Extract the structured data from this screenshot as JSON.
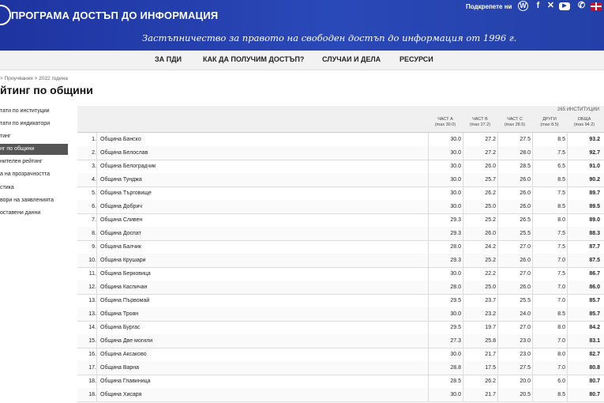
{
  "header": {
    "org_name": "ПРОГРАМА ДОСТЪП ДО ИНФОРМАЦИЯ",
    "tagline": "Застъпничество за правото на свободен достъп до информация от 1996 г.",
    "support_label": "Подкрепете ни",
    "social_icons": [
      "wordpress-icon",
      "facebook-icon",
      "twitter-icon",
      "youtube-icon",
      "phone-icon",
      "uk-flag-icon"
    ]
  },
  "nav": {
    "items": [
      "ЗА ПДИ",
      "КАК ДА ПОЛУЧИМ ДОСТЪП?",
      "СЛУЧАИ И ДЕЛА",
      "РЕСУРСИ"
    ]
  },
  "breadcrumb": "> Проучвания > 2022 година",
  "page_title": "йтинг по общини",
  "sidebar": {
    "items": [
      {
        "label": "тати по институции",
        "active": false
      },
      {
        "label": "тати по индикатори",
        "active": false
      },
      {
        "label": "тинг",
        "active": false
      },
      {
        "label": "нг по общини",
        "active": true
      },
      {
        "label": "нителен рейтинг",
        "active": false
      },
      {
        "label": "а на прозрачността",
        "active": false
      },
      {
        "label": "стика",
        "active": false
      },
      {
        "label": "вори на заявленията",
        "active": false
      },
      {
        "label": "оставени данни",
        "active": false
      }
    ]
  },
  "table": {
    "count_label": "265 ИНСТИТУЦИИ",
    "headers": [
      {
        "label": "ЧАСТ А",
        "sub": "(max 30.0)"
      },
      {
        "label": "ЧАСТ В",
        "sub": "(max 27.2)"
      },
      {
        "label": "ЧАСТ С",
        "sub": "(max 28.5)"
      },
      {
        "label": "ДРУГИ",
        "sub": "(max 8.5)"
      },
      {
        "label": "ОБЩА",
        "sub": "(max 94.2)"
      }
    ],
    "rows": [
      {
        "rank": "1.",
        "name": "Община Банско",
        "a": "30.0",
        "b": "27.2",
        "c": "27.5",
        "o": "8.5",
        "t": "93.2"
      },
      {
        "rank": "2.",
        "name": "Община Белослав",
        "a": "30.0",
        "b": "27.2",
        "c": "28.0",
        "o": "7.5",
        "t": "92.7"
      },
      {
        "rank": "3.",
        "name": "Община Белоградчик",
        "a": "30.0",
        "b": "26.0",
        "c": "28.5",
        "o": "6.5",
        "t": "91.0"
      },
      {
        "rank": "4.",
        "name": "Община Тунджа",
        "a": "30.0",
        "b": "25.7",
        "c": "26.0",
        "o": "8.5",
        "t": "90.2"
      },
      {
        "rank": "5.",
        "name": "Община Търговище",
        "a": "30.0",
        "b": "26.2",
        "c": "26.0",
        "o": "7.5",
        "t": "89.7"
      },
      {
        "rank": "6.",
        "name": "Община Добрич",
        "a": "30.0",
        "b": "25.0",
        "c": "26.0",
        "o": "8.5",
        "t": "89.5"
      },
      {
        "rank": "7.",
        "name": "Община Сливен",
        "a": "29.3",
        "b": "25.2",
        "c": "26.5",
        "o": "8.0",
        "t": "89.0"
      },
      {
        "rank": "8.",
        "name": "Община Доспат",
        "a": "29.3",
        "b": "26.0",
        "c": "25.5",
        "o": "7.5",
        "t": "88.3"
      },
      {
        "rank": "9.",
        "name": "Община Балчик",
        "a": "28.0",
        "b": "24.2",
        "c": "27.0",
        "o": "7.5",
        "t": "87.7"
      },
      {
        "rank": "10.",
        "name": "Община Крушари",
        "a": "29.3",
        "b": "25.2",
        "c": "26.0",
        "o": "7.0",
        "t": "87.5"
      },
      {
        "rank": "11.",
        "name": "Община Берковица",
        "a": "30.0",
        "b": "22.2",
        "c": "27.0",
        "o": "7.5",
        "t": "86.7"
      },
      {
        "rank": "12.",
        "name": "Община Каспичан",
        "a": "28.0",
        "b": "25.0",
        "c": "26.0",
        "o": "7.0",
        "t": "86.0"
      },
      {
        "rank": "13.",
        "name": "Община Първомай",
        "a": "29.5",
        "b": "23.7",
        "c": "25.5",
        "o": "7.0",
        "t": "85.7"
      },
      {
        "rank": "13.",
        "name": "Община Троян",
        "a": "30.0",
        "b": "23.2",
        "c": "24.0",
        "o": "8.5",
        "t": "85.7"
      },
      {
        "rank": "14.",
        "name": "Община Бургас",
        "a": "29.5",
        "b": "19.7",
        "c": "27.0",
        "o": "8.0",
        "t": "84.2"
      },
      {
        "rank": "15.",
        "name": "Община Две могили",
        "a": "27.3",
        "b": "25.8",
        "c": "23.0",
        "o": "7.0",
        "t": "83.1"
      },
      {
        "rank": "16.",
        "name": "Община Аксаково",
        "a": "30.0",
        "b": "21.7",
        "c": "23.0",
        "o": "8.0",
        "t": "82.7"
      },
      {
        "rank": "17.",
        "name": "Община Варна",
        "a": "28.8",
        "b": "17.5",
        "c": "27.5",
        "o": "7.0",
        "t": "80.8"
      },
      {
        "rank": "18.",
        "name": "Община Главиница",
        "a": "28.5",
        "b": "26.2",
        "c": "20.0",
        "o": "6.0",
        "t": "80.7"
      },
      {
        "rank": "18.",
        "name": "Община Хисаря",
        "a": "30.0",
        "b": "21.7",
        "c": "20.5",
        "o": "8.5",
        "t": "80.7"
      }
    ]
  }
}
